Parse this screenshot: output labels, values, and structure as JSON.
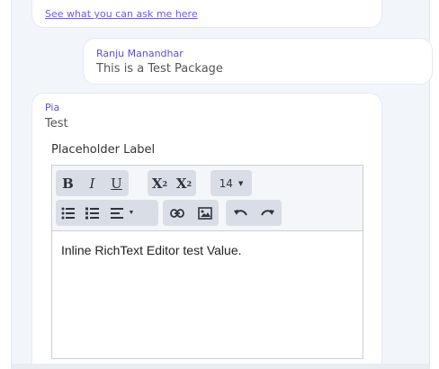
{
  "top_bubble": {
    "help_link": "See what you can ask me here"
  },
  "user_message": {
    "sender": "Ranju Manandhar",
    "text": "This is a Test Package"
  },
  "bot_message": {
    "sender": "Pia",
    "text": "Test",
    "field_label": "Placeholder Label"
  },
  "editor": {
    "toolbar": {
      "bold": "B",
      "italic": "I",
      "underline": "U",
      "superscript_base": "X",
      "superscript_mark": "2",
      "subscript_base": "X",
      "subscript_mark": "2",
      "font_size": "14",
      "icons": [
        "bullet-list-icon",
        "numbered-list-icon",
        "align-icon",
        "link-icon",
        "image-icon",
        "undo-icon",
        "redo-icon"
      ]
    },
    "content": "Inline RichText Editor test Value."
  },
  "colors": {
    "accent": "#5b4fd1",
    "chat_background": "#f2f6fb",
    "toolbar_button": "#d9dee6"
  }
}
